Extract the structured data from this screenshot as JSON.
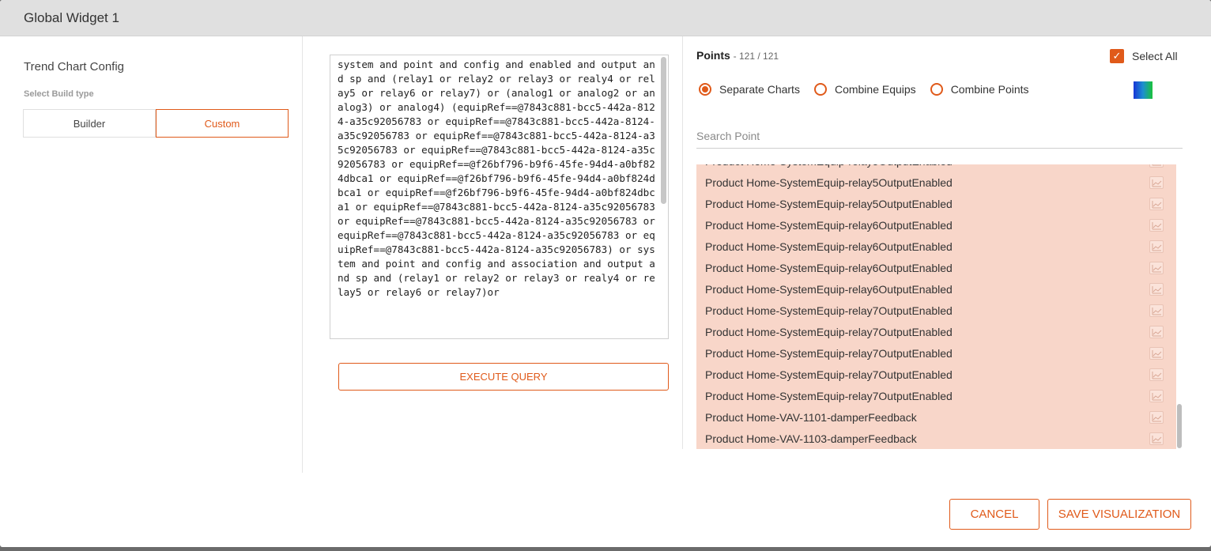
{
  "modal": {
    "title": "Global Widget 1"
  },
  "left": {
    "section_title": "Trend Chart Config",
    "build_type_label": "Select Build type",
    "builder_label": "Builder",
    "custom_label": "Custom"
  },
  "middle": {
    "query": "system and point and config and enabled and output and sp and (relay1 or relay2 or relay3 or realy4 or relay5 or relay6 or relay7) or (analog1 or analog2 or analog3) or analog4) (equipRef==@7843c881-bcc5-442a-8124-a35c92056783 or equipRef==@7843c881-bcc5-442a-8124-a35c92056783 or equipRef==@7843c881-bcc5-442a-8124-a35c92056783 or equipRef==@7843c881-bcc5-442a-8124-a35c92056783 or equipRef==@f26bf796-b9f6-45fe-94d4-a0bf824dbca1 or equipRef==@f26bf796-b9f6-45fe-94d4-a0bf824dbca1 or equipRef==@f26bf796-b9f6-45fe-94d4-a0bf824dbca1 or equipRef==@7843c881-bcc5-442a-8124-a35c92056783 or equipRef==@7843c881-bcc5-442a-8124-a35c92056783 or equipRef==@7843c881-bcc5-442a-8124-a35c92056783 or equipRef==@7843c881-bcc5-442a-8124-a35c92056783) or system and point and config and association and output and sp and (relay1 or relay2 or relay3 or realy4 or relay5 or relay6 or relay7)or",
    "execute_label": "EXECUTE QUERY"
  },
  "right": {
    "points_label": "Points",
    "points_count": "- 121 / 121",
    "select_all_label": "Select All",
    "radio_options": [
      "Separate Charts",
      "Combine Equips",
      "Combine Points"
    ],
    "selected_radio": "Separate Charts",
    "search_placeholder": "Search Point",
    "points": [
      "Product Home-SystemEquip-relay5OutputEnabled",
      "Product Home-SystemEquip-relay5OutputEnabled",
      "Product Home-SystemEquip-relay5OutputEnabled",
      "Product Home-SystemEquip-relay6OutputEnabled",
      "Product Home-SystemEquip-relay6OutputEnabled",
      "Product Home-SystemEquip-relay6OutputEnabled",
      "Product Home-SystemEquip-relay6OutputEnabled",
      "Product Home-SystemEquip-relay7OutputEnabled",
      "Product Home-SystemEquip-relay7OutputEnabled",
      "Product Home-SystemEquip-relay7OutputEnabled",
      "Product Home-SystemEquip-relay7OutputEnabled",
      "Product Home-SystemEquip-relay7OutputEnabled",
      "Product Home-VAV-1101-damperFeedback",
      "Product Home-VAV-1103-damperFeedback"
    ],
    "accent_color": "#e05a1a",
    "row_bg_color": "#f8d6c9"
  },
  "footer": {
    "cancel_label": "CANCEL",
    "save_label": "SAVE VISUALIZATION"
  }
}
